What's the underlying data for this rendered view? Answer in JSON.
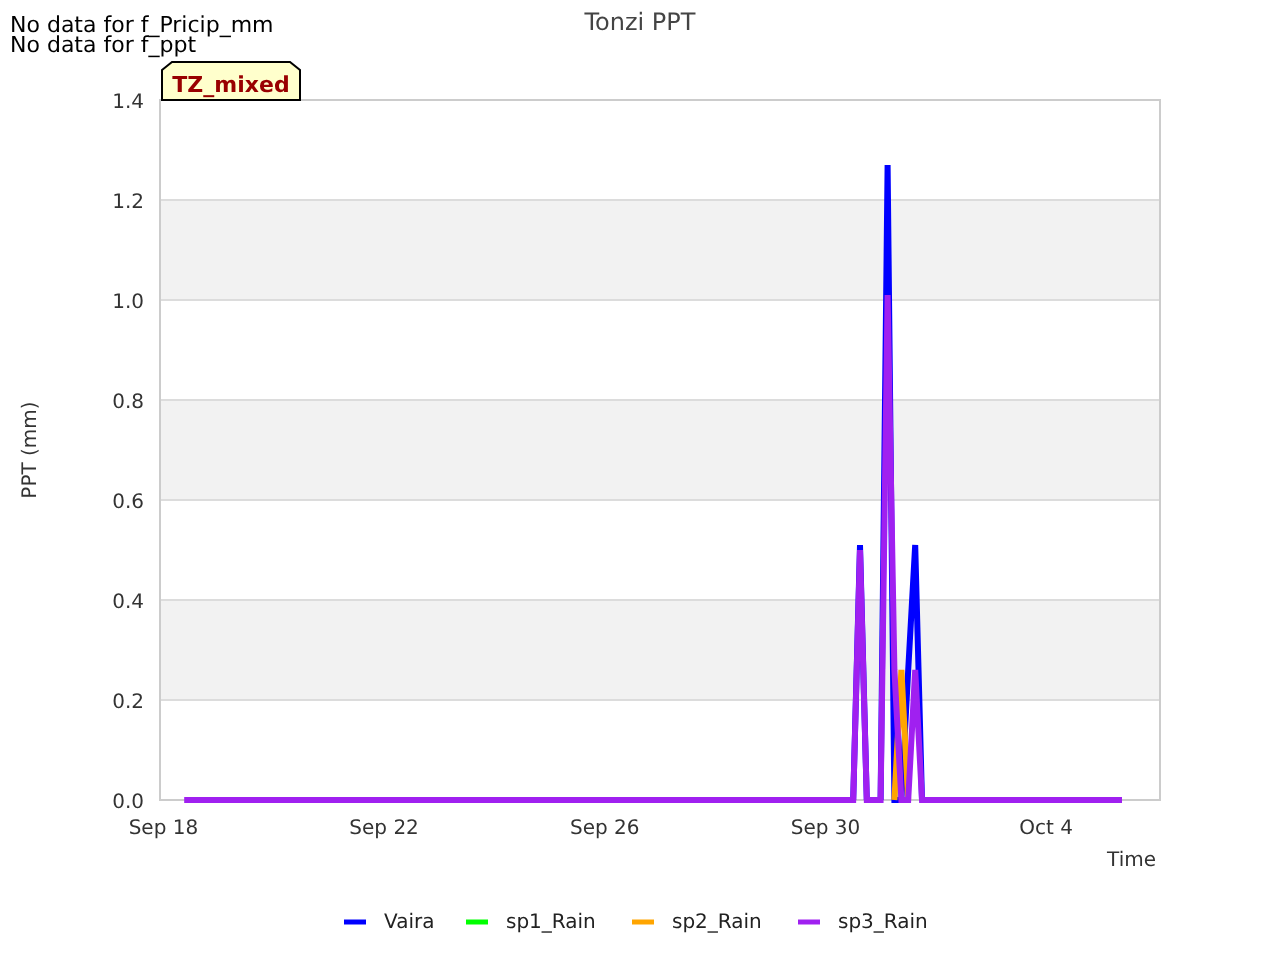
{
  "notes": [
    "No data for f_Pricip_mm",
    "No data for f_ppt"
  ],
  "badge": "TZ_mixed",
  "chart_data": {
    "type": "line",
    "title": "Tonzi PPT",
    "xlabel": "Time",
    "ylabel": "PPT (mm)",
    "categories": [
      "Sep 18",
      null,
      null,
      null,
      null,
      null,
      null,
      null,
      null,
      null,
      null,
      null,
      null,
      null,
      null,
      null,
      null,
      null,
      null,
      null,
      null,
      null,
      null,
      null,
      null,
      null,
      null,
      null,
      null,
      null,
      null,
      null,
      "Sep 22",
      null,
      null,
      null,
      null,
      null,
      null,
      null,
      null,
      null,
      null,
      null,
      null,
      null,
      null,
      null,
      null,
      null,
      null,
      null,
      null,
      null,
      null,
      null,
      null,
      null,
      null,
      null,
      null,
      null,
      null,
      null,
      "Sep 26",
      null,
      null,
      null,
      null,
      null,
      null,
      null,
      null,
      null,
      null,
      null,
      null,
      null,
      null,
      null,
      null,
      null,
      null,
      null,
      null,
      null,
      null,
      null,
      null,
      null,
      null,
      null,
      null,
      null,
      null,
      null,
      "Sep 30",
      null,
      null,
      null,
      null,
      null,
      null,
      null,
      null,
      null,
      null,
      null,
      null,
      null,
      null,
      null,
      null,
      null,
      null,
      null,
      null,
      null,
      null,
      null,
      null,
      null,
      null,
      null,
      null,
      null,
      null,
      null,
      "Oct 4",
      null,
      null,
      null,
      null,
      null,
      null,
      null,
      null,
      null,
      null,
      null,
      null,
      null,
      null,
      null,
      null
    ],
    "series": [
      {
        "name": "Vaira",
        "color": "#0000ff",
        "values": [
          null,
          null,
          null,
          null,
          null,
          null,
          null,
          null,
          null,
          null,
          null,
          null,
          null,
          null,
          null,
          null,
          null,
          null,
          null,
          null,
          null,
          null,
          null,
          null,
          null,
          null,
          null,
          null,
          null,
          null,
          null,
          null,
          null,
          null,
          null,
          null,
          null,
          null,
          null,
          null,
          null,
          null,
          null,
          null,
          null,
          null,
          null,
          null,
          null,
          null,
          null,
          null,
          null,
          null,
          null,
          null,
          null,
          null,
          null,
          null,
          null,
          null,
          null,
          null,
          null,
          null,
          null,
          null,
          null,
          null,
          null,
          null,
          null,
          null,
          null,
          null,
          null,
          null,
          null,
          null,
          null,
          null,
          null,
          null,
          null,
          null,
          null,
          null,
          null,
          null,
          null,
          null,
          null,
          null,
          null,
          null,
          null,
          null,
          null,
          null,
          0,
          0.51,
          0,
          null,
          0,
          1.27,
          0,
          0,
          0.26,
          0.51,
          0,
          null,
          null,
          null,
          null,
          null,
          null,
          null,
          null,
          null,
          null,
          null,
          null,
          null,
          null,
          null,
          null,
          null,
          null,
          null,
          null,
          null,
          null,
          null,
          null,
          null,
          null,
          null,
          null,
          null,
          null,
          null,
          null,
          null,
          null
        ]
      },
      {
        "name": "sp1_Rain",
        "color": "#00ff00",
        "values": [
          null,
          null,
          null,
          null,
          null,
          null,
          null,
          null,
          null,
          null,
          null,
          null,
          null,
          null,
          null,
          null,
          null,
          null,
          null,
          null,
          null,
          null,
          null,
          null,
          null,
          null,
          null,
          null,
          null,
          null,
          null,
          null,
          null,
          null,
          null,
          null,
          null,
          null,
          null,
          null,
          null,
          null,
          null,
          null,
          null,
          null,
          null,
          null,
          null,
          null,
          null,
          null,
          null,
          null,
          null,
          null,
          null,
          null,
          null,
          null,
          null,
          null,
          null,
          null,
          null,
          null,
          null,
          null,
          null,
          null,
          null,
          null,
          null,
          null,
          null,
          null,
          null,
          null,
          null,
          null,
          null,
          null,
          null,
          null,
          null,
          null,
          null,
          null,
          null,
          null,
          null,
          null,
          null,
          null,
          null,
          null,
          null,
          null,
          null,
          null,
          null,
          null,
          null,
          null,
          null,
          null,
          null,
          null,
          null,
          null,
          null,
          null,
          null,
          null,
          null,
          null,
          null,
          null,
          null,
          null,
          null,
          null,
          null,
          null,
          null,
          null,
          null,
          null,
          null,
          null,
          null,
          null,
          null,
          null,
          null,
          null,
          null,
          null,
          null,
          null,
          null,
          null,
          null,
          null,
          null
        ]
      },
      {
        "name": "sp2_Rain",
        "color": "#ffa500",
        "values": [
          null,
          null,
          null,
          null,
          null,
          null,
          null,
          null,
          null,
          null,
          null,
          null,
          null,
          null,
          null,
          null,
          null,
          null,
          null,
          null,
          null,
          null,
          null,
          null,
          null,
          null,
          null,
          null,
          null,
          null,
          null,
          null,
          null,
          null,
          null,
          null,
          null,
          null,
          null,
          null,
          null,
          null,
          null,
          null,
          null,
          null,
          null,
          null,
          null,
          null,
          null,
          null,
          null,
          null,
          null,
          null,
          null,
          null,
          null,
          null,
          null,
          null,
          null,
          null,
          null,
          null,
          null,
          null,
          null,
          null,
          null,
          null,
          null,
          null,
          null,
          null,
          null,
          null,
          null,
          null,
          null,
          null,
          null,
          null,
          null,
          null,
          null,
          null,
          null,
          null,
          null,
          null,
          null,
          null,
          null,
          null,
          null,
          null,
          null,
          null,
          null,
          null,
          null,
          null,
          null,
          null,
          0,
          0.26,
          0,
          null,
          null,
          null,
          null,
          null,
          null,
          null,
          null,
          null,
          null,
          null,
          null,
          null,
          null,
          null,
          null,
          null,
          null,
          null,
          null,
          null,
          null,
          null,
          null,
          null,
          null,
          null,
          null,
          null,
          null,
          null,
          null,
          null,
          null,
          null,
          null
        ]
      },
      {
        "name": "sp3_Rain",
        "color": "#a020f0",
        "values": [
          null,
          null,
          null,
          0,
          0,
          0,
          0,
          0,
          0,
          0,
          0,
          0,
          0,
          0,
          0,
          0,
          0,
          0,
          0,
          0,
          0,
          0,
          0,
          0,
          0,
          0,
          0,
          0,
          0,
          0,
          0,
          0,
          0,
          0,
          0,
          0,
          0,
          0,
          0,
          0,
          0,
          0,
          0,
          0,
          0,
          0,
          0,
          0,
          0,
          0,
          0,
          0,
          0,
          0,
          0,
          0,
          0,
          0,
          0,
          0,
          0,
          0,
          0,
          0,
          0,
          0,
          0,
          0,
          0,
          0,
          0,
          0,
          0,
          0,
          0,
          0,
          0,
          0,
          0,
          0,
          0,
          0,
          0,
          0,
          0,
          0,
          0,
          0,
          0,
          0,
          0,
          0,
          0,
          0,
          0,
          0,
          0,
          0,
          0,
          0,
          0,
          0.5,
          0,
          0,
          0,
          1.01,
          0.26,
          0,
          0,
          0.26,
          0,
          0,
          0,
          0,
          0,
          0,
          0,
          0,
          0,
          0,
          0,
          0,
          0,
          0,
          0,
          0,
          0,
          0,
          0,
          0,
          0,
          0,
          0,
          0,
          0,
          0,
          0,
          0,
          0,
          0,
          null,
          null,
          null,
          null,
          null
        ]
      }
    ],
    "ylim": [
      0,
      1.4
    ],
    "grid": true,
    "legend": "bottom",
    "yticks": [
      {
        "value": 0,
        "label": "0.0"
      },
      {
        "value": 0.2,
        "label": "0.2"
      },
      {
        "value": 0.4,
        "label": "0.4"
      },
      {
        "value": 0.6,
        "label": "0.6"
      },
      {
        "value": 0.8,
        "label": "0.8"
      },
      {
        "value": 1.0,
        "label": "1.0"
      },
      {
        "value": 1.2,
        "label": "1.2"
      },
      {
        "value": 1.4,
        "label": "1.4"
      }
    ]
  }
}
